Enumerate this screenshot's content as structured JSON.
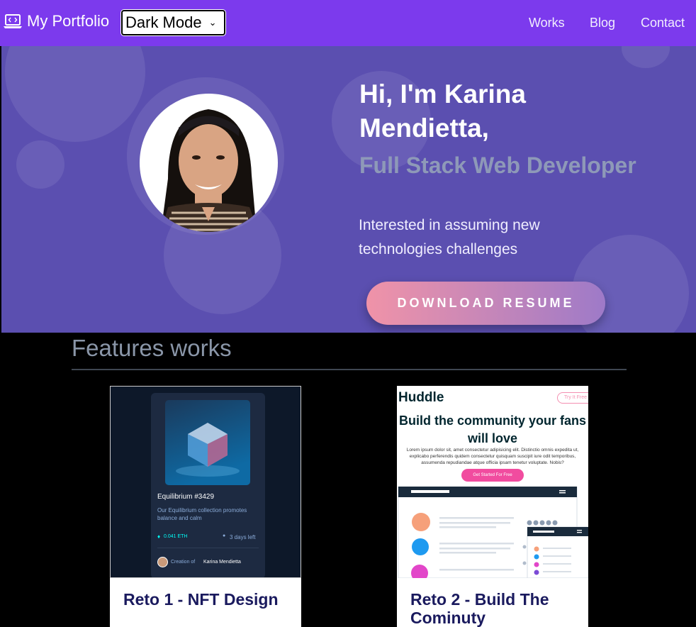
{
  "nav": {
    "brand": "My Portfolio",
    "mode_selected": "Dark Mode",
    "links": [
      "Works",
      "Blog",
      "Contact"
    ]
  },
  "hero": {
    "title": "Hi, I'm Karina Mendietta,",
    "subtitle": "Full Stack Web Developer",
    "text": "Interested in assuming new technologies challenges",
    "button": "DOWNLOAD RESUME"
  },
  "features": {
    "title": "Features works",
    "cards": [
      {
        "title": "Reto 1 - NFT Design",
        "preview": {
          "name": "Equilibrium #3429",
          "desc": "Our Equilibrium collection promotes balance and calm",
          "price": "0.041 ETH",
          "time": "3 days left",
          "creation_prefix": "Creation of",
          "creator": "Karina Mendietta"
        }
      },
      {
        "title": "Reto 2 - Build The Cominuty",
        "preview": {
          "logo": "Huddle",
          "try": "Try It Free",
          "headline": "Build the community your fans will love",
          "body": "Lorem ipsum dolor sit, amet consectetur adipisicing elit. Distinctio omnis expedita ut, explicabo perferendis quidem consectetur quisquam suscipit iure odit temporibus, assumenda repudiandae atque officia ipsam tenetur voluptate. Nobis?",
          "cta": "Get Started For Free"
        }
      }
    ]
  },
  "colors": {
    "navbar": "#7c3aed",
    "hero": "#5b4fb0",
    "card_title": "#1a1a5e",
    "button_start": "#f093a8",
    "button_end": "#9e7ac8"
  }
}
